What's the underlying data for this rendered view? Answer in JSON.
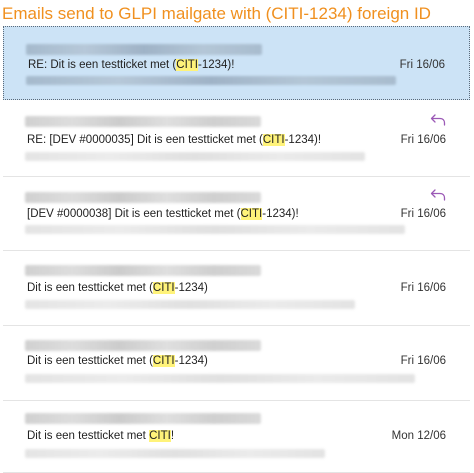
{
  "page": {
    "title": "Emails send to GLPI mailgate with (CITI-1234) foreign ID"
  },
  "colors": {
    "title": "#f0901f",
    "selected_background": "#cce3f6",
    "highlight": "#fff37a",
    "reply_icon": "#9b59b6"
  },
  "emails": [
    {
      "subject_before": "RE: Dit is een testticket met (",
      "subject_highlight": "CITI",
      "subject_after": "-1234)!",
      "date": "Fri 16/06",
      "selected": true,
      "replied": false
    },
    {
      "subject_before": "RE: [DEV #0000035] Dit is een testticket met (",
      "subject_highlight": "CITI",
      "subject_after": "-1234)!",
      "date": "Fri 16/06",
      "selected": false,
      "replied": true,
      "reply_icon": "reply-arrow-icon"
    },
    {
      "subject_before": "[DEV #0000038] Dit is een testticket met (",
      "subject_highlight": "CITI",
      "subject_after": "-1234)!",
      "date": "Fri 16/06",
      "selected": false,
      "replied": true,
      "reply_icon": "reply-arrow-icon"
    },
    {
      "subject_before": "Dit is een testticket met (",
      "subject_highlight": "CITI",
      "subject_after": "-1234)",
      "date": "Fri 16/06",
      "selected": false,
      "replied": false
    },
    {
      "subject_before": "Dit is een testticket met (",
      "subject_highlight": "CITI",
      "subject_after": "-1234)",
      "date": "Fri 16/06",
      "selected": false,
      "replied": false
    },
    {
      "subject_before": "Dit is een testticket met ",
      "subject_highlight": "CITI",
      "subject_after": "!",
      "date": "Mon 12/06",
      "selected": false,
      "replied": false
    }
  ]
}
